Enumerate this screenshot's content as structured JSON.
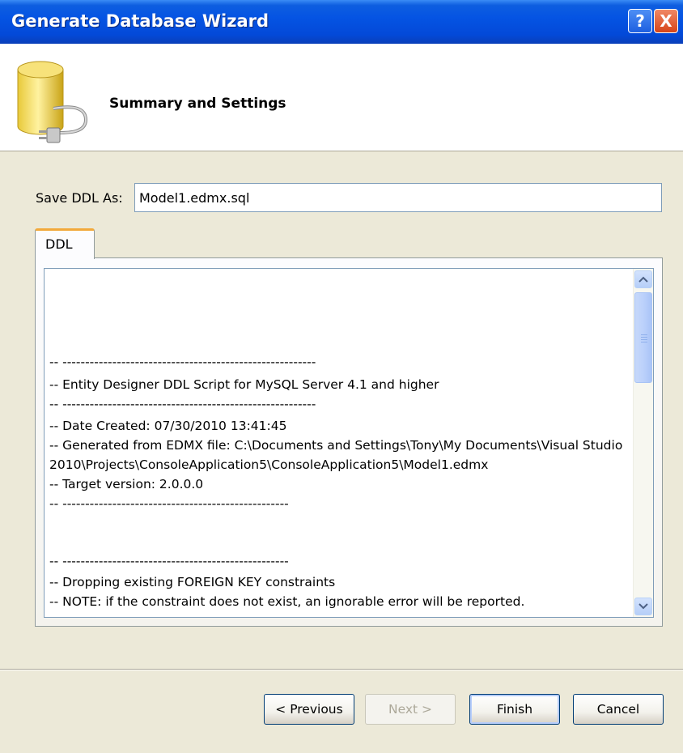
{
  "window": {
    "title": "Generate Database Wizard",
    "help_glyph": "?",
    "close_glyph": "X"
  },
  "header": {
    "icon": "database-plug-icon",
    "title": "Summary and Settings"
  },
  "save_ddl": {
    "label": "Save DDL As:",
    "value": "Model1.edmx.sql"
  },
  "tabs": [
    {
      "label": "DDL",
      "selected": true
    }
  ],
  "ddl_script": {
    "lines": [
      "",
      "",
      "",
      "",
      "-- --------------------------------------------------------",
      "-- Entity Designer DDL Script for MySQL Server 4.1 and higher",
      "-- --------------------------------------------------------",
      "-- Date Created: 07/30/2010 13:41:45",
      "-- Generated from EDMX file: C:\\Documents and Settings\\Tony\\My Documents\\Visual Studio",
      "2010\\Projects\\ConsoleApplication5\\ConsoleApplication5\\Model1.edmx",
      "-- Target version: 2.0.0.0",
      "-- --------------------------------------------------",
      "",
      "",
      "",
      "-- --------------------------------------------------",
      "-- Dropping existing FOREIGN KEY constraints",
      "-- NOTE: if the constraint does not exist, an ignorable error will be reported."
    ]
  },
  "buttons": {
    "previous": "< Previous",
    "next": "Next >",
    "finish": "Finish",
    "cancel": "Cancel"
  },
  "colors": {
    "titlebar": "#0554e3",
    "dialog_bg": "#ece9d8",
    "tab_highlight": "#f2a93b"
  }
}
